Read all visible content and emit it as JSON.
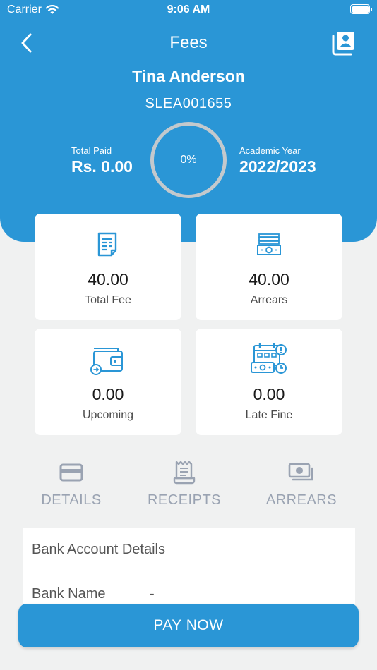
{
  "status_bar": {
    "carrier": "Carrier",
    "time": "9:06 AM"
  },
  "nav": {
    "title": "Fees"
  },
  "student": {
    "name": "Tina Anderson",
    "id": "SLEA001655"
  },
  "summary": {
    "paid_label": "Total Paid",
    "paid_value": "Rs. 0.00",
    "progress_text": "0%",
    "progress_fraction": 0,
    "year_label": "Academic Year",
    "year_value": "2022/2023"
  },
  "cards": [
    {
      "value": "40.00",
      "label": "Total Fee",
      "icon": "invoice-icon"
    },
    {
      "value": "40.00",
      "label": "Arrears",
      "icon": "cash-stack-icon"
    },
    {
      "value": "0.00",
      "label": "Upcoming",
      "icon": "wallet-icon"
    },
    {
      "value": "0.00",
      "label": "Late Fine",
      "icon": "calendar-money-icon"
    }
  ],
  "tabs": [
    {
      "label": "DETAILS",
      "icon": "credit-card-icon"
    },
    {
      "label": "RECEIPTS",
      "icon": "receipt-icon"
    },
    {
      "label": "ARREARS",
      "icon": "money-icon"
    }
  ],
  "bank": {
    "title": "Bank Account Details",
    "name_label": "Bank Name",
    "name_value": "-"
  },
  "pay_button": {
    "label": "PAY NOW"
  },
  "colors": {
    "primary": "#2a96d6",
    "background": "#f0f1f1",
    "tab_inactive": "#9aa3b2",
    "ring": "#c3c9cd"
  }
}
